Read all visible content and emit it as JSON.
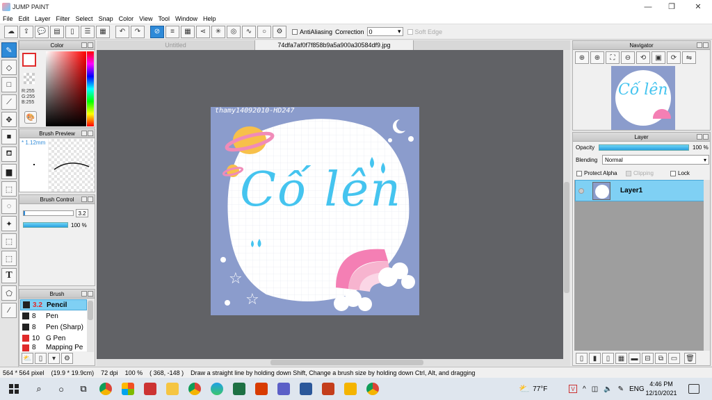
{
  "window": {
    "title": "JUMP PAINT"
  },
  "menu": [
    "File",
    "Edit",
    "Layer",
    "Filter",
    "Select",
    "Snap",
    "Color",
    "View",
    "Tool",
    "Window",
    "Help"
  ],
  "toolbar": {
    "antialiasing_label": "AntiAliasing",
    "correction_label": "Correction",
    "correction_value": "0",
    "soft_edge_label": "Soft Edge"
  },
  "color_panel": {
    "title": "Color",
    "r": "R:255",
    "g": "G:255",
    "b": "B:255"
  },
  "brush_preview": {
    "title": "Brush Preview",
    "size": "* 1.12mm"
  },
  "brush_control": {
    "title": "Brush Control",
    "size_value": "3.2",
    "opacity_value": "100 %"
  },
  "brush_panel": {
    "title": "Brush",
    "items": [
      {
        "size": "3.2",
        "name": "Pencil",
        "color": "#222222",
        "selected": true
      },
      {
        "size": "8",
        "name": "Pen",
        "color": "#222222",
        "selected": false
      },
      {
        "size": "8",
        "name": "Pen (Sharp)",
        "color": "#222222",
        "selected": false
      },
      {
        "size": "10",
        "name": "G Pen",
        "color": "#e02a2a",
        "selected": false
      },
      {
        "size": "8",
        "name": "Mapping Pe",
        "color": "#e02a2a",
        "selected": false
      }
    ]
  },
  "doc_tabs": {
    "untitled": "Untitled",
    "active": "74dfa7af0f7f858b9a5a900a30584df9.jpg"
  },
  "artwork": {
    "signature": "thamy14092010-HD247",
    "main_text": "Cố lên"
  },
  "navigator": {
    "title": "Navigator",
    "thumb_text": "Cố lên"
  },
  "layer_panel": {
    "title": "Layer",
    "opacity_label": "Opacity",
    "opacity_value": "100 %",
    "blending_label": "Blending",
    "blending_value": "Normal",
    "protect_alpha": "Protect Alpha",
    "clipping": "Clipping",
    "lock": "Lock",
    "layer_name": "Layer1"
  },
  "status": {
    "size": "564 * 564 pixel",
    "cm": "(19.9 * 19.9cm)",
    "dpi": "72 dpi",
    "zoom": "100 %",
    "coords": "( 368, -148 )",
    "hint": "Draw a straight line by holding down Shift, Change a brush size by holding down Ctrl, Alt, and dragging"
  },
  "taskbar": {
    "weather": "77°F",
    "lang": "ENG",
    "time": "4:46 PM",
    "date": "12/10/2021"
  },
  "colors": {
    "accent": "#2e8ad8",
    "canvas_bg": "#616266",
    "art_bg": "#8b9ccc",
    "art_text": "#45c4ef"
  }
}
